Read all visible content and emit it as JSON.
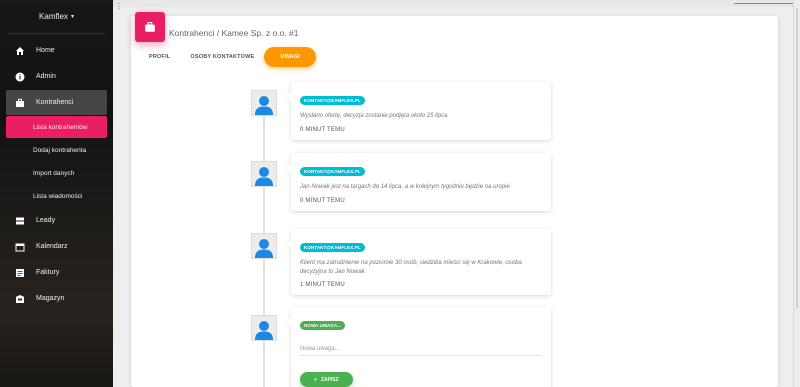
{
  "sidebar": {
    "brand": "Kamflex",
    "items": [
      {
        "label": "Home",
        "icon": "home-icon"
      },
      {
        "label": "Admin",
        "icon": "info-icon"
      },
      {
        "label": "Kontrahenci",
        "icon": "briefcase-icon"
      }
    ],
    "subitems": [
      {
        "label": "Lista kontrahentów"
      },
      {
        "label": "Dodaj kontrahenta"
      },
      {
        "label": "Import danych"
      },
      {
        "label": "Lista wiadomości"
      }
    ],
    "items2": [
      {
        "label": "Leady",
        "icon": "storage-icon"
      },
      {
        "label": "Kalendarz",
        "icon": "calendar-icon"
      },
      {
        "label": "Faktury",
        "icon": "list-icon"
      },
      {
        "label": "Magazyn",
        "icon": "store-icon"
      }
    ]
  },
  "header": {
    "title": "Kontrahenci / Kamee Sp. z o.o. #1"
  },
  "tabs": [
    {
      "label": "PROFIL"
    },
    {
      "label": "OSOBY KONTAKTOWE"
    },
    {
      "label": "UWAGI"
    }
  ],
  "timeline": [
    {
      "author": "KONTAKT@KAMFLEX.PL",
      "text": "Wysłano ofertę, decyzja zostanie podjęta około 25 lipca",
      "time": "0 MINUT TEMU"
    },
    {
      "author": "KONTAKT@KAMFLEX.PL",
      "text": "Jan Nowak jest na targach do 14 lipca, a w kolejnym tygodniu będzie na uropie",
      "time": "0 MINUT TEMU"
    },
    {
      "author": "KONTAKT@KAMFLEX.PL",
      "text": "Klient ma zatrudnienie na poziomie 30 osób, siedziba mieści się w Krakowie, osoba decyzyjna to Jan Nowak",
      "time": "1 MINUT TEMU"
    }
  ],
  "new_note": {
    "badge": "NOWA UWAGA...",
    "placeholder": "Nowa uwaga...",
    "save_label": "ZAPISZ"
  },
  "colors": {
    "accent": "#e91e63",
    "tab_active": "#ff9800",
    "badge": "#00bcd4",
    "save": "#4caf50"
  }
}
